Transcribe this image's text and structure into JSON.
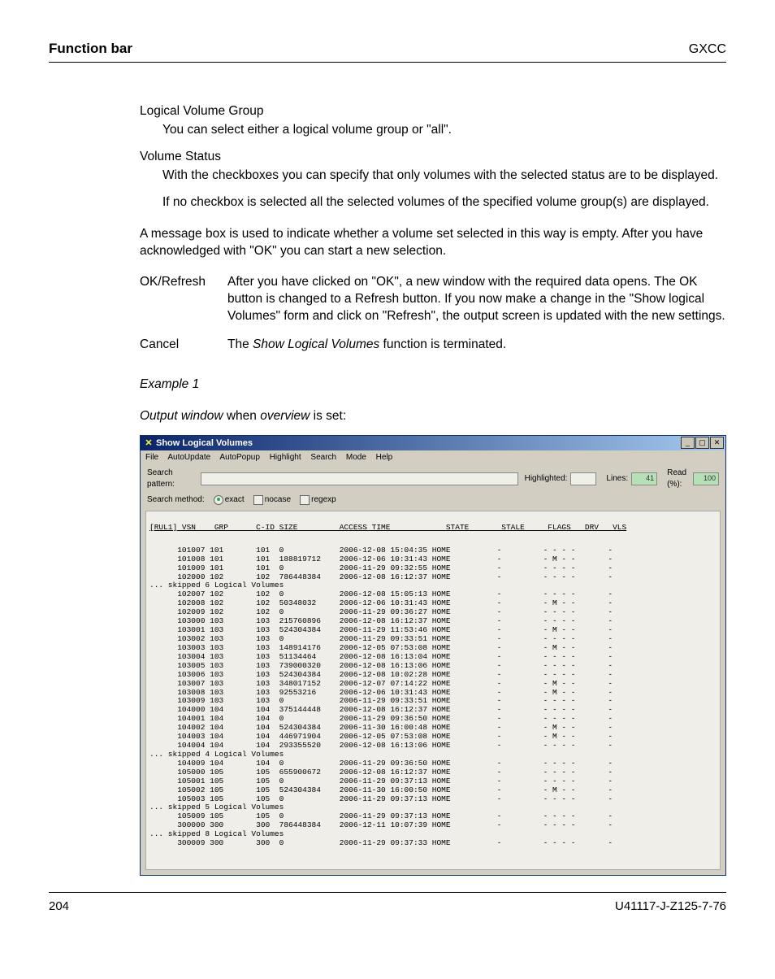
{
  "header": {
    "left": "Function bar",
    "right": "GXCC"
  },
  "defs": [
    {
      "term": "Logical Volume Group",
      "body": "You can select either a logical volume group or \"all\"."
    },
    {
      "term": "Volume Status",
      "body": "With the checkboxes you can specify that only volumes with the selected status are to be displayed.",
      "body2": "If no checkbox is selected all the selected volumes of the specified volume group(s) are displayed."
    }
  ],
  "para1": "A message box is used to indicate whether a volume set selected in this way is empty. After you have acknowledged with \"OK\" you can start a new selection.",
  "cols": [
    {
      "label": "OK/Refresh",
      "desc": "After you have clicked on \"OK\", a new window with the required data opens. The OK button is changed to a Refresh button. If you now make a change in the \"Show logical Volumes\" form and click on \"Refresh\", the output screen is updated with the new settings."
    },
    {
      "label": "Cancel",
      "desc_pre": "The ",
      "desc_it": "Show Logical Volumes",
      "desc_post": " function is terminated."
    }
  ],
  "example_label": "Example 1",
  "output_pre": "Output window",
  "output_mid": " when ",
  "output_it": "overview",
  "output_post": " is set:",
  "win": {
    "title": "Show Logical Volumes",
    "menus": [
      "File",
      "AutoUpdate",
      "AutoPopup",
      "Highlight",
      "Search",
      "Mode",
      "Help"
    ],
    "search_label": "Search pattern:",
    "highlighted_label": "Highlighted:",
    "lines_label": "Lines:",
    "lines_val": "41",
    "read_label": "Read (%):",
    "read_val": "100",
    "method_label": "Search method:",
    "methods": [
      "exact",
      "nocase",
      "regexp"
    ],
    "table_header": "[RUL1] VSN    GRP      C-ID SIZE         ACCESS TIME            STATE       STALE     FLAGS   DRV   VLS",
    "rows": [
      "      101007 101       101  0            2006-12-08 15:04:35 HOME          -         - - - -       -",
      "      101008 101       101  188819712    2006-12-06 10:31:43 HOME          -         - M - -       -",
      "      101009 101       101  0            2006-11-29 09:32:55 HOME          -         - - - -       -",
      "      102000 102       102  786448384    2006-12-08 16:12:37 HOME          -         - - - -       -",
      "... skipped 6 Logical Volumes",
      "      102007 102       102  0            2006-12-08 15:05:13 HOME          -         - - - -       -",
      "      102008 102       102  50348032     2006-12-06 10:31:43 HOME          -         - M - -       -",
      "      102009 102       102  0            2006-11-29 09:36:27 HOME          -         - - - -       -",
      "      103000 103       103  215760896    2006-12-08 16:12:37 HOME          -         - - - -       -",
      "      103001 103       103  524304384    2006-11-29 11:53:46 HOME          -         - M - -       -",
      "      103002 103       103  0            2006-11-29 09:33:51 HOME          -         - - - -       -",
      "      103003 103       103  148914176    2006-12-05 07:53:08 HOME          -         - M - -       -",
      "      103004 103       103  51134464     2006-12-08 16:13:04 HOME          -         - - - -       -",
      "      103005 103       103  739000320    2006-12-08 16:13:06 HOME          -         - - - -       -",
      "      103006 103       103  524304384    2006-12-08 10:02:28 HOME          -         - - - -       -",
      "      103007 103       103  348017152    2006-12-07 07:14:22 HOME          -         - M - -       -",
      "      103008 103       103  92553216     2006-12-06 10:31:43 HOME          -         - M - -       -",
      "      103009 103       103  0            2006-11-29 09:33:51 HOME          -         - - - -       -",
      "      104000 104       104  375144448    2006-12-08 16:12:37 HOME          -         - - - -       -",
      "      104001 104       104  0            2006-11-29 09:36:50 HOME          -         - - - -       -",
      "      104002 104       104  524304384    2006-11-30 16:00:48 HOME          -         - M - -       -",
      "      104003 104       104  446971904    2006-12-05 07:53:08 HOME          -         - M - -       -",
      "      104004 104       104  293355520    2006-12-08 16:13:06 HOME          -         - - - -       -",
      "... skipped 4 Logical Volumes",
      "      104009 104       104  0            2006-11-29 09:36:50 HOME          -         - - - -       -",
      "      105000 105       105  655900672    2006-12-08 16:12:37 HOME          -         - - - -       -",
      "      105001 105       105  0            2006-11-29 09:37:13 HOME          -         - - - -       -",
      "      105002 105       105  524304384    2006-11-30 16:00:50 HOME          -         - M - -       -",
      "      105003 105       105  0            2006-11-29 09:37:13 HOME          -         - - - -       -",
      "... skipped 5 Logical Volumes",
      "      105009 105       105  0            2006-11-29 09:37:13 HOME          -         - - - -       -",
      "      300000 300       300  786448384    2006-12-11 10:07:39 HOME          -         - - - -       -",
      "... skipped 8 Logical Volumes",
      "      300009 300       300  0            2006-11-29 09:37:33 HOME          -         - - - -       -"
    ]
  },
  "footer": {
    "page": "204",
    "docid": "U41117-J-Z125-7-76"
  }
}
